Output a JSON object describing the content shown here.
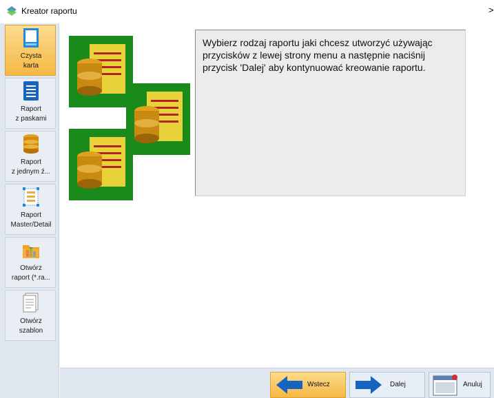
{
  "window": {
    "title": "Kreator raportu",
    "chevron": ">"
  },
  "sidebar": {
    "items": [
      {
        "line1": "Czysta",
        "line2": "karta",
        "active": true,
        "icon": "blank-page-icon"
      },
      {
        "line1": "Raport",
        "line2": "z paskami",
        "active": false,
        "icon": "bands-report-icon"
      },
      {
        "line1": "Raport",
        "line2": "z jednym ź...",
        "active": false,
        "icon": "database-icon"
      },
      {
        "line1": "Raport",
        "line2": "Master/Detail",
        "active": false,
        "icon": "master-detail-icon"
      },
      {
        "line1": "Otwórz",
        "line2": "raport (*.ra...",
        "active": false,
        "icon": "open-report-icon"
      },
      {
        "line1": "Otwórz",
        "line2": "szablon",
        "active": false,
        "icon": "open-template-icon"
      }
    ]
  },
  "main": {
    "description": "Wybierz  rodzaj  raportu jaki chcesz utworzyć używając przycisków z lewej strony menu a następnie naciśnij przycisk 'Dalej' aby kontynuować kreowanie raportu."
  },
  "footer": {
    "back_label": "Wstecz",
    "next_label": "Dalej",
    "cancel_label": "Anuluj"
  },
  "colors": {
    "accent": "#f6b844",
    "sidebar": "#dfe6ef",
    "picture_bg": "#1a8a1a",
    "arrow": "#1565c0"
  }
}
